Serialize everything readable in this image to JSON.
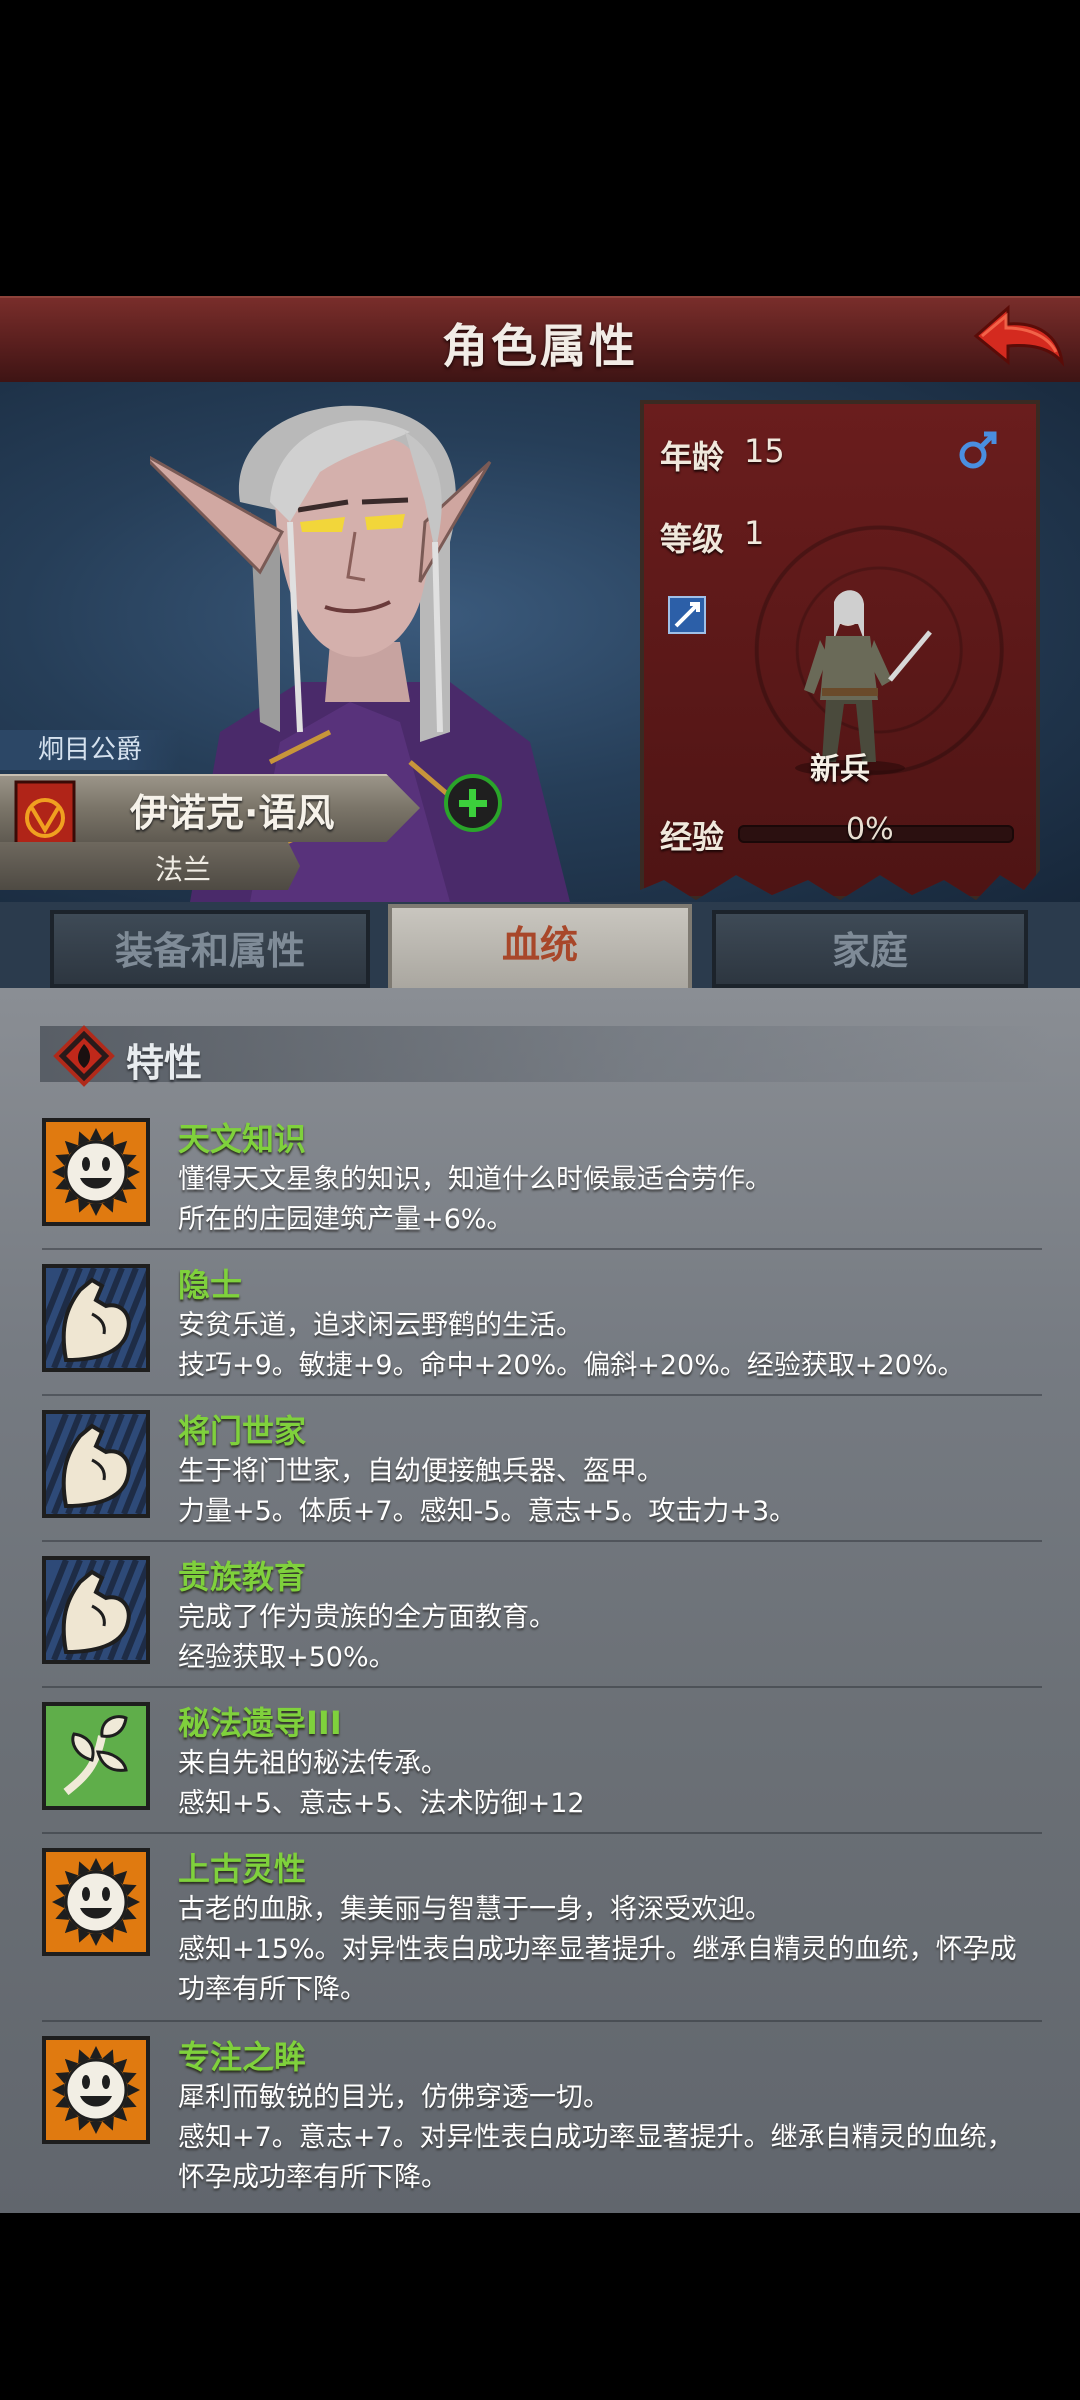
{
  "header": {
    "title": "角色属性"
  },
  "character": {
    "title_label": "炯目公爵",
    "name": "伊诺克·语风",
    "country": "法兰"
  },
  "stats": {
    "age_label": "年龄",
    "age_value": "15",
    "level_label": "等级",
    "level_value": "1",
    "rank": "新兵",
    "exp_label": "经验",
    "exp_value": "0%",
    "exp_fraction": 0.0,
    "gender_icon": "male-icon"
  },
  "tabs": [
    {
      "label": "装备和属性"
    },
    {
      "label": "血统"
    },
    {
      "label": "家庭"
    }
  ],
  "section": {
    "title": "特性",
    "icon": "fire-diamond-icon"
  },
  "traits": [
    {
      "name": "天文知识",
      "icon": "sun-face-icon",
      "desc": "懂得天文星象的知识，知道什么时候最适合劳作。\n所在的庄园建筑产量+6%。"
    },
    {
      "name": "隐士",
      "icon": "flexed-arm-icon",
      "desc": "安贫乐道，追求闲云野鹤的生活。\n技巧+9。敏捷+9。命中+20%。偏斜+20%。经验获取+20%。"
    },
    {
      "name": "将门世家",
      "icon": "flexed-arm-icon",
      "desc": "生于将门世家，自幼便接触兵器、盔甲。\n力量+5。体质+7。感知-5。意志+5。攻击力+3。"
    },
    {
      "name": "贵族教育",
      "icon": "flexed-arm-icon",
      "desc": "完成了作为贵族的全方面教育。\n经验获取+50%。"
    },
    {
      "name": "秘法遗导III",
      "icon": "sprout-icon",
      "desc": "来自先祖的秘法传承。\n感知+5、意志+5、法术防御+12"
    },
    {
      "name": "上古灵性",
      "icon": "sun-face-icon",
      "desc": "古老的血脉，集美丽与智慧于一身，将深受欢迎。\n感知+15%。对异性表白成功率显著提升。继承自精灵的血统，怀孕成\n功率有所下降。"
    },
    {
      "name": "专注之眸",
      "icon": "sun-face-icon",
      "desc": "犀利而敏锐的目光，仿佛穿透一切。\n感知+7。意志+7。对异性表白成功率显著提升。继承自精灵的血统，\n怀孕成功率有所下降。"
    }
  ],
  "colors": {
    "header": "#5a1f1e",
    "trait_name": "#7fd13c",
    "active_tab_text": "#a8472a",
    "stats_panel": "#5a1818"
  }
}
